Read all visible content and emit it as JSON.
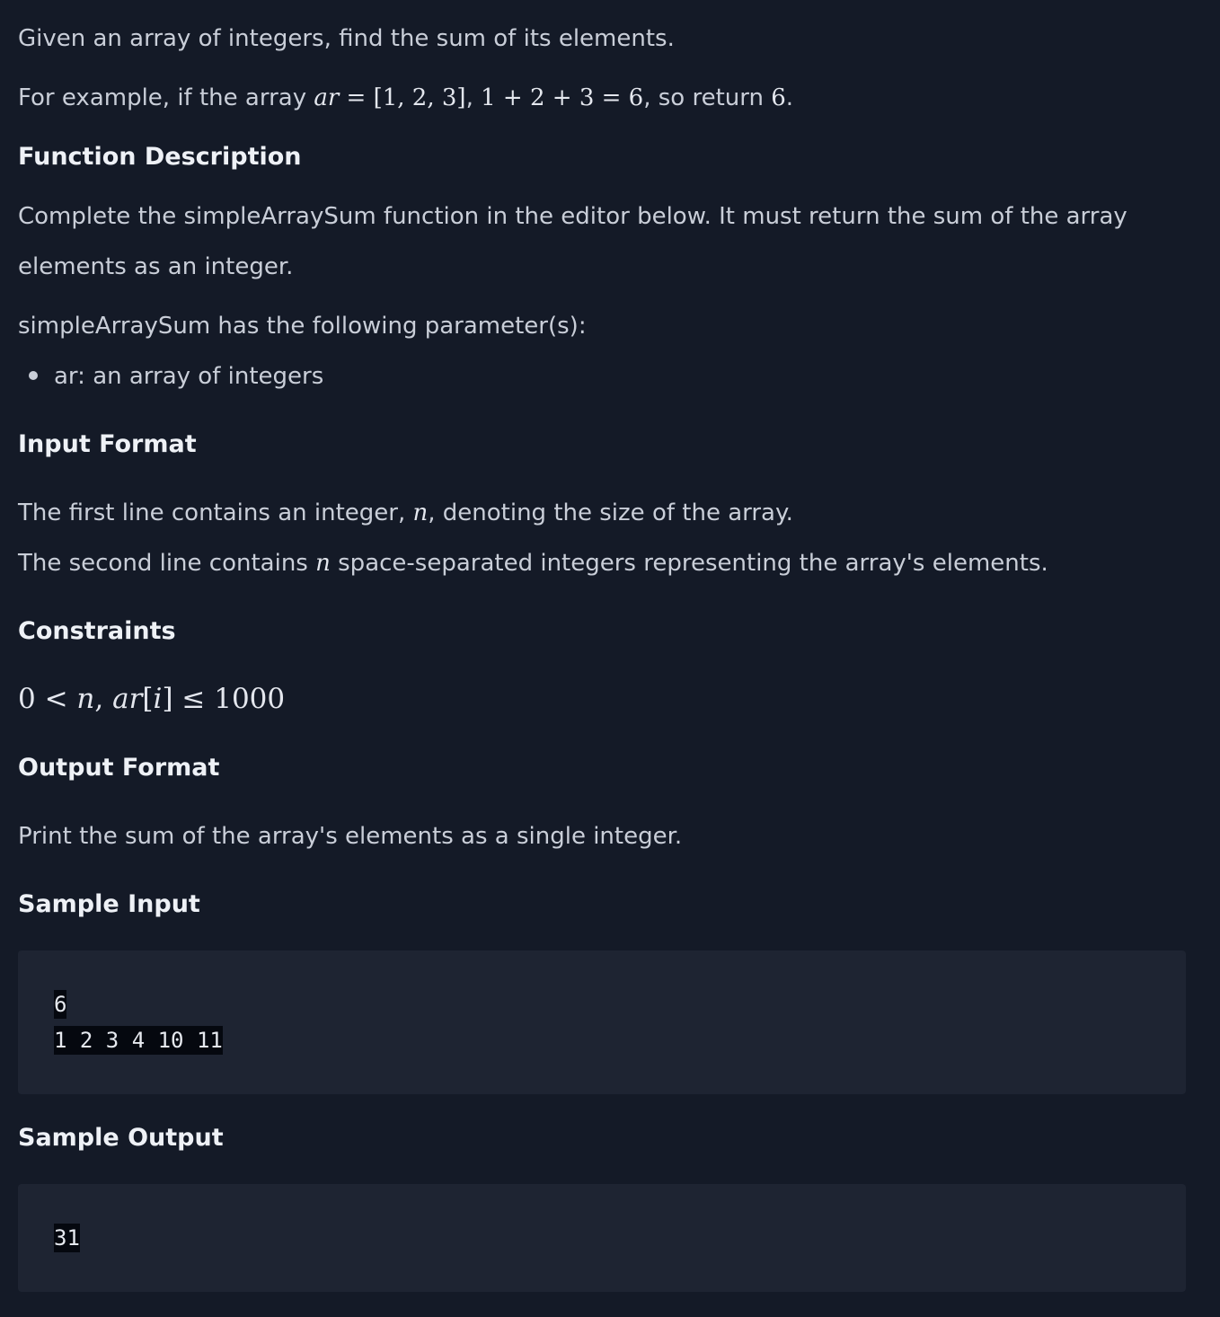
{
  "intro": {
    "line1": "Given an array of integers, find the sum of its elements.",
    "example_prefix": "For example, if the array ",
    "example_math1": "ar = [1, 2, 3]",
    "example_sep": ", ",
    "example_math2": "1 + 2 + 3 = 6",
    "example_mid": ", so return ",
    "example_math3": "6",
    "example_end": "."
  },
  "function_description": {
    "heading": "Function Description",
    "body": "Complete the simpleArraySum function in the editor below. It must return the sum of the array elements as an integer.",
    "params_intro": "simpleArraySum has the following parameter(s):",
    "params": [
      "ar: an array of integers"
    ]
  },
  "input_format": {
    "heading": "Input Format",
    "line1_prefix": "The first line contains an integer, ",
    "line1_var": "n",
    "line1_suffix": ", denoting the size of the array.",
    "line2_prefix": "The second line contains ",
    "line2_var": "n",
    "line2_suffix": " space-separated integers representing the array's elements."
  },
  "constraints": {
    "heading": "Constraints",
    "expression": "0 < n, ar[i] ≤ 1000"
  },
  "output_format": {
    "heading": "Output Format",
    "body": "Print the sum of the array's elements as a single integer."
  },
  "sample_input": {
    "heading": "Sample Input",
    "lines": [
      "6",
      "1 2 3 4 10 11"
    ]
  },
  "sample_output": {
    "heading": "Sample Output",
    "lines": [
      "31"
    ]
  }
}
